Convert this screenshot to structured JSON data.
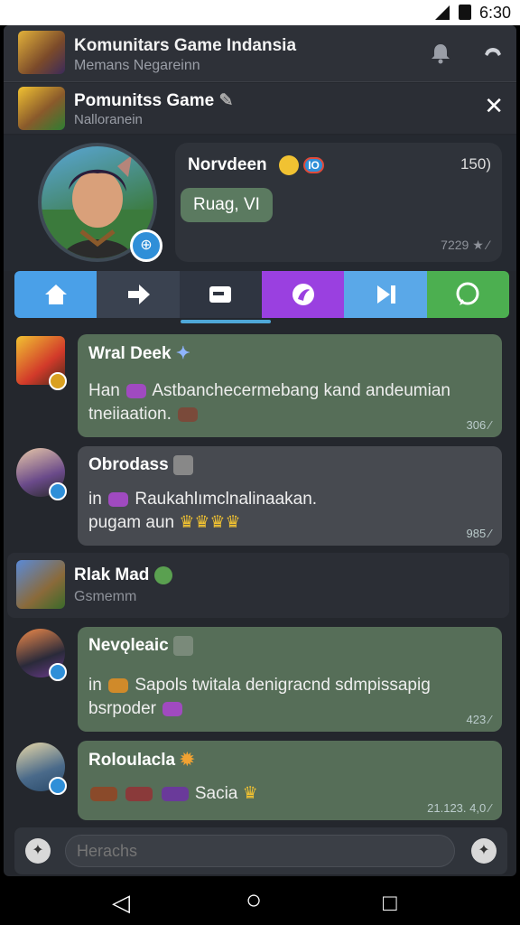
{
  "status": {
    "time": "6:30"
  },
  "header": {
    "title": "Komunitars Game Indansia",
    "subtitle": "Memans Negareinn"
  },
  "sub": {
    "title": "Pomunitss Game",
    "subtitle": "Nalloranein",
    "close": "✕"
  },
  "profile": {
    "name": "Norvdeen",
    "count": "150)",
    "pill": "Ruag, VI",
    "footer": "7229",
    "name_badge": "IO"
  },
  "nav": {
    "icons": [
      "home-icon",
      "arrow-icon",
      "chat-icon",
      "discord-icon",
      "play-icon",
      "whatsapp-icon"
    ],
    "colors": [
      "#4aa0e8",
      "#3a4250",
      "#2f3541",
      "#9a40e0",
      "#5aa8e8",
      "#4caf50"
    ]
  },
  "messages": [
    {
      "name": "Wral Deek",
      "text1": "Han",
      "text2": "Astbanchecermebang kand andeumian",
      "text3": "tneiiaation.",
      "time": "306"
    },
    {
      "name": "Obrodass",
      "text1": "in",
      "text2": "Raukahlımclnalinaakan.",
      "text3": "pugam aun",
      "time": "985"
    },
    {
      "name": "Rlak Mad",
      "sub": "Gsmemm"
    },
    {
      "name": "Nevǫleaic",
      "text1": "in",
      "text2": "Sapols twitala denigracnd sdmpissapig",
      "text3": "bsrpoder",
      "time": "423"
    },
    {
      "name": "Roloulacla",
      "text": "Sacia",
      "time": "21.123.  4,0"
    }
  ],
  "composer": {
    "placeholder": "Herachs"
  },
  "android": {
    "back": "◁",
    "home": "○",
    "recent": "□"
  }
}
